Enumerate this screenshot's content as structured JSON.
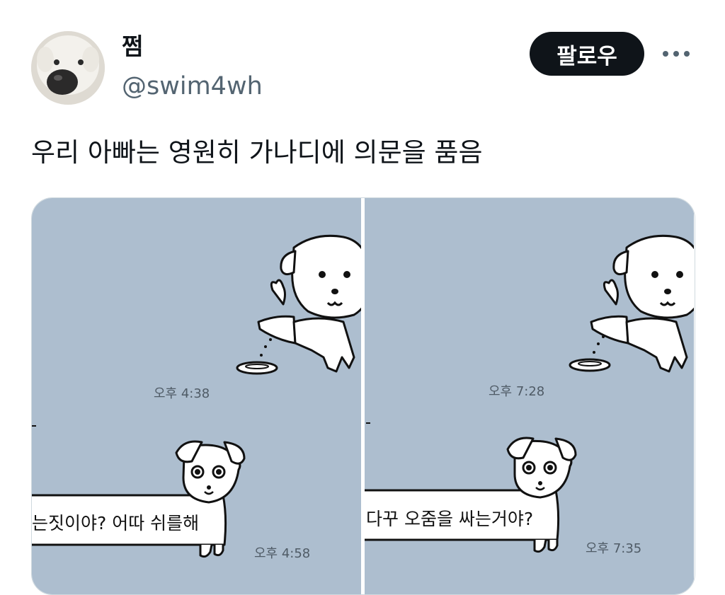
{
  "user": {
    "name": "쩜",
    "handle": "@swim4wh"
  },
  "actions": {
    "follow_label": "팔로우",
    "more_icon": "more-horizontal-icon"
  },
  "tweet": {
    "text": "우리 아빠는 영원히 가나디에 의문을 품음"
  },
  "media": {
    "left": {
      "time_top": "오후 4:38",
      "message": "는짓이야? 어따 쉬를해",
      "time_bottom": "오후 4:58"
    },
    "right": {
      "time_top": "오후 7:28",
      "message": "다꾸 오줌을 싸는거야?",
      "time_bottom": "오후 7:35"
    }
  },
  "colors": {
    "chat_bg": "#adbecf",
    "follow_bg": "#0f1419",
    "handle": "#536471"
  }
}
